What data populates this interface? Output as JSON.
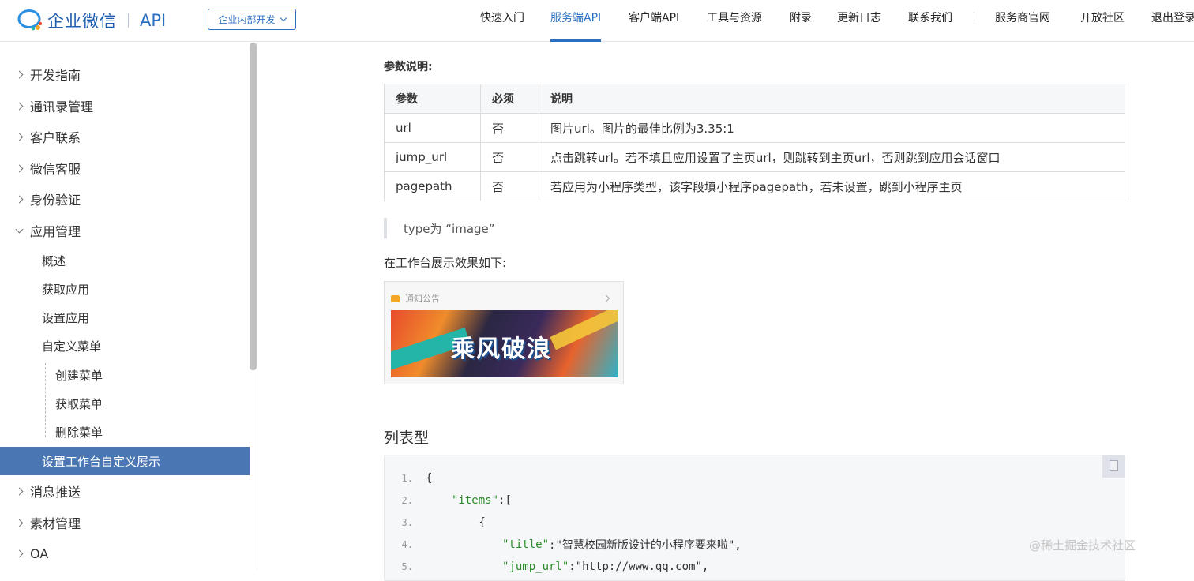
{
  "header": {
    "logo_text": "企业微信",
    "logo_api": "API",
    "dev_select": "企业内部开发",
    "nav": [
      "快速入门",
      "服务端API",
      "客户端API",
      "工具与资源",
      "附录",
      "更新日志",
      "联系我们",
      "服务商官网",
      "开放社区",
      "退出登录"
    ],
    "active_nav": "服务端API",
    "accent_color": "#2b6fc2"
  },
  "sidebar": {
    "items": [
      "开发指南",
      "通讯录管理",
      "客户联系",
      "微信客服",
      "身份验证",
      "应用管理"
    ],
    "app_sub": [
      "概述",
      "获取应用",
      "设置应用",
      "自定义菜单"
    ],
    "menu_sub": [
      "创建菜单",
      "获取菜单",
      "删除菜单"
    ],
    "active": "设置工作台自定义展示",
    "after": [
      "消息推送",
      "素材管理",
      "OA"
    ],
    "active_color": "#4a76b3"
  },
  "main": {
    "param_title": "参数说明:",
    "table": {
      "headers": [
        "参数",
        "必须",
        "说明"
      ],
      "rows": [
        [
          "url",
          "否",
          "图片url。图片的最佳比例为3.35:1"
        ],
        [
          "jump_url",
          "否",
          "点击跳转url。若不填且应用设置了主页url，则跳转到主页url，否则跳到应用会话窗口"
        ],
        [
          "pagepath",
          "否",
          "若应用为小程序类型，该字段填小程序pagepath，若未设置，跳到小程序主页"
        ]
      ]
    },
    "quote": "type为 “image”",
    "show_text": "在工作台展示效果如下:",
    "preview_title": "通知公告",
    "banner_text": "乘风破浪",
    "section_title": "列表型",
    "code": [
      {
        "n": "1.",
        "text": "{"
      },
      {
        "n": "2.",
        "key": "\"items\"",
        "rest": ":["
      },
      {
        "n": "3.",
        "text": "        {"
      },
      {
        "n": "4.",
        "key": "\"title\"",
        "rest": ":\"智慧校园新版设计的小程序要来啦\","
      },
      {
        "n": "5.",
        "key": "\"jump_url\"",
        "rest": ":\"http://www.qq.com\","
      }
    ]
  },
  "watermark": "@稀土掘金技术社区"
}
